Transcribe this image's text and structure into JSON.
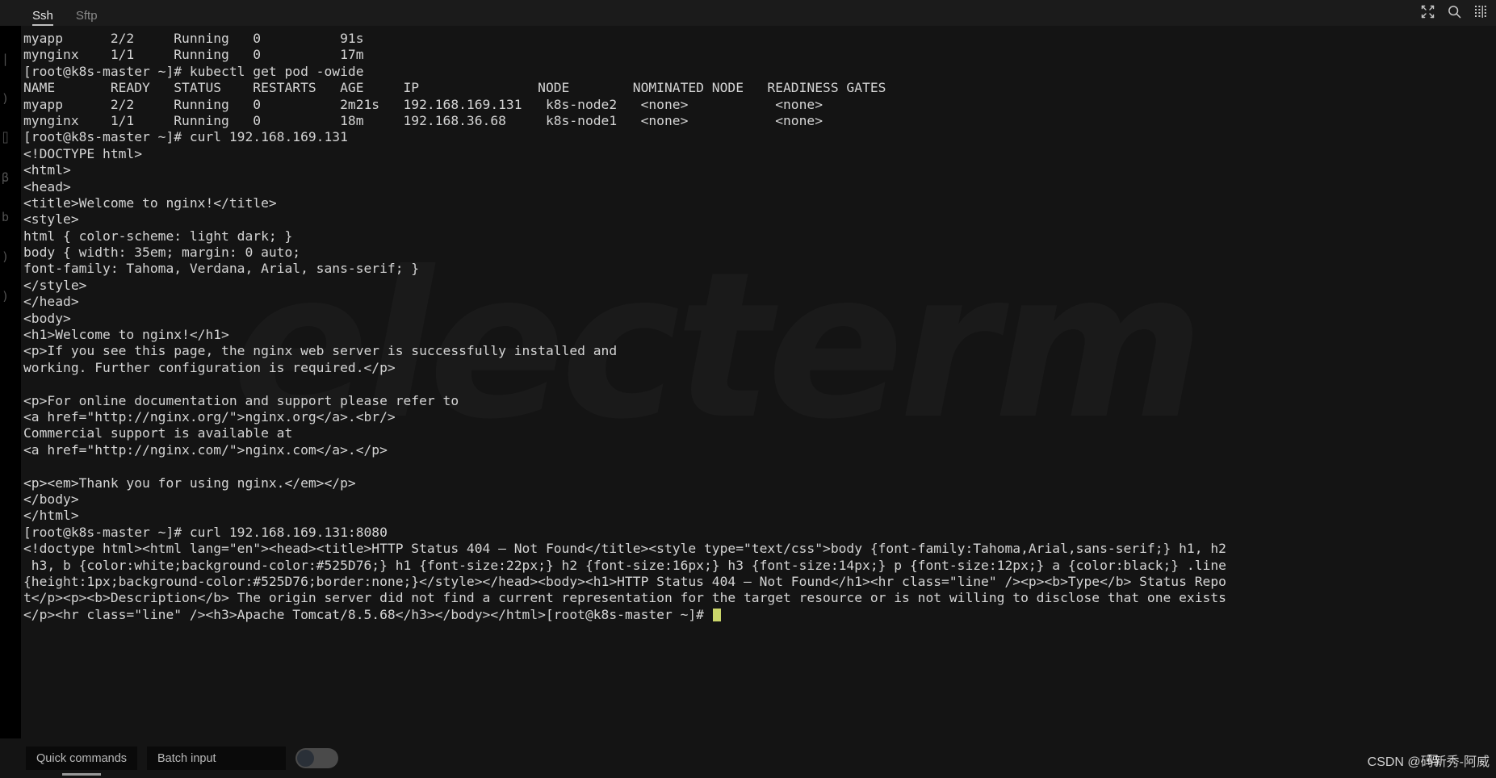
{
  "window": {
    "tabs": [
      {
        "label": "Ssh",
        "active": true
      },
      {
        "label": "Sftp",
        "active": false
      }
    ],
    "icons": [
      {
        "name": "fullscreen-icon",
        "glyph": "expand"
      },
      {
        "name": "search-icon",
        "glyph": "magnifier"
      },
      {
        "name": "layout-icon",
        "glyph": "grid"
      }
    ]
  },
  "watermark": {
    "text": "electerm"
  },
  "terminal": {
    "prompt": "[root@k8s-master ~]#",
    "cursor_color": "#cad56a",
    "lines": [
      "myapp      2/2     Running   0          91s",
      "mynginx    1/1     Running   0          17m",
      "[root@k8s-master ~]# kubectl get pod -owide",
      "NAME       READY   STATUS    RESTARTS   AGE     IP               NODE        NOMINATED NODE   READINESS GATES",
      "myapp      2/2     Running   0          2m21s   192.168.169.131   k8s-node2   <none>           <none>",
      "mynginx    1/1     Running   0          18m     192.168.36.68     k8s-node1   <none>           <none>",
      "[root@k8s-master ~]# curl 192.168.169.131",
      "<!DOCTYPE html>",
      "<html>",
      "<head>",
      "<title>Welcome to nginx!</title>",
      "<style>",
      "html { color-scheme: light dark; }",
      "body { width: 35em; margin: 0 auto;",
      "font-family: Tahoma, Verdana, Arial, sans-serif; }",
      "</style>",
      "</head>",
      "<body>",
      "<h1>Welcome to nginx!</h1>",
      "<p>If you see this page, the nginx web server is successfully installed and",
      "working. Further configuration is required.</p>",
      "",
      "<p>For online documentation and support please refer to",
      "<a href=\"http://nginx.org/\">nginx.org</a>.<br/>",
      "Commercial support is available at",
      "<a href=\"http://nginx.com/\">nginx.com</a>.</p>",
      "",
      "<p><em>Thank you for using nginx.</em></p>",
      "</body>",
      "</html>",
      "[root@k8s-master ~]# curl 192.168.169.131:8080",
      "<!doctype html><html lang=\"en\"><head><title>HTTP Status 404 – Not Found</title><style type=\"text/css\">body {font-family:Tahoma,Arial,sans-serif;} h1, h2",
      " h3, b {color:white;background-color:#525D76;} h1 {font-size:22px;} h2 {font-size:16px;} h3 {font-size:14px;} p {font-size:12px;} a {color:black;} .line",
      "{height:1px;background-color:#525D76;border:none;}</style></head><body><h1>HTTP Status 404 – Not Found</h1><hr class=\"line\" /><p><b>Type</b> Status Repo",
      "t</p><p><b>Description</b> The origin server did not find a current representation for the target resource or is not willing to disclose that one exists",
      "</p><hr class=\"line\" /><h3>Apache Tomcat/8.5.68</h3></body></html>[root@k8s-master ~]# "
    ],
    "rail_glyphs": ")\n|\n)\n⌷\nβ\nb\n)\n)"
  },
  "bottombar": {
    "quick_commands_label": "Quick commands",
    "batch_input_label": "Batch input",
    "toggle_state": "off"
  },
  "overlay": {
    "csdn_text": "CSDN @码新秀-阿威",
    "csdn_overlap": "码"
  }
}
